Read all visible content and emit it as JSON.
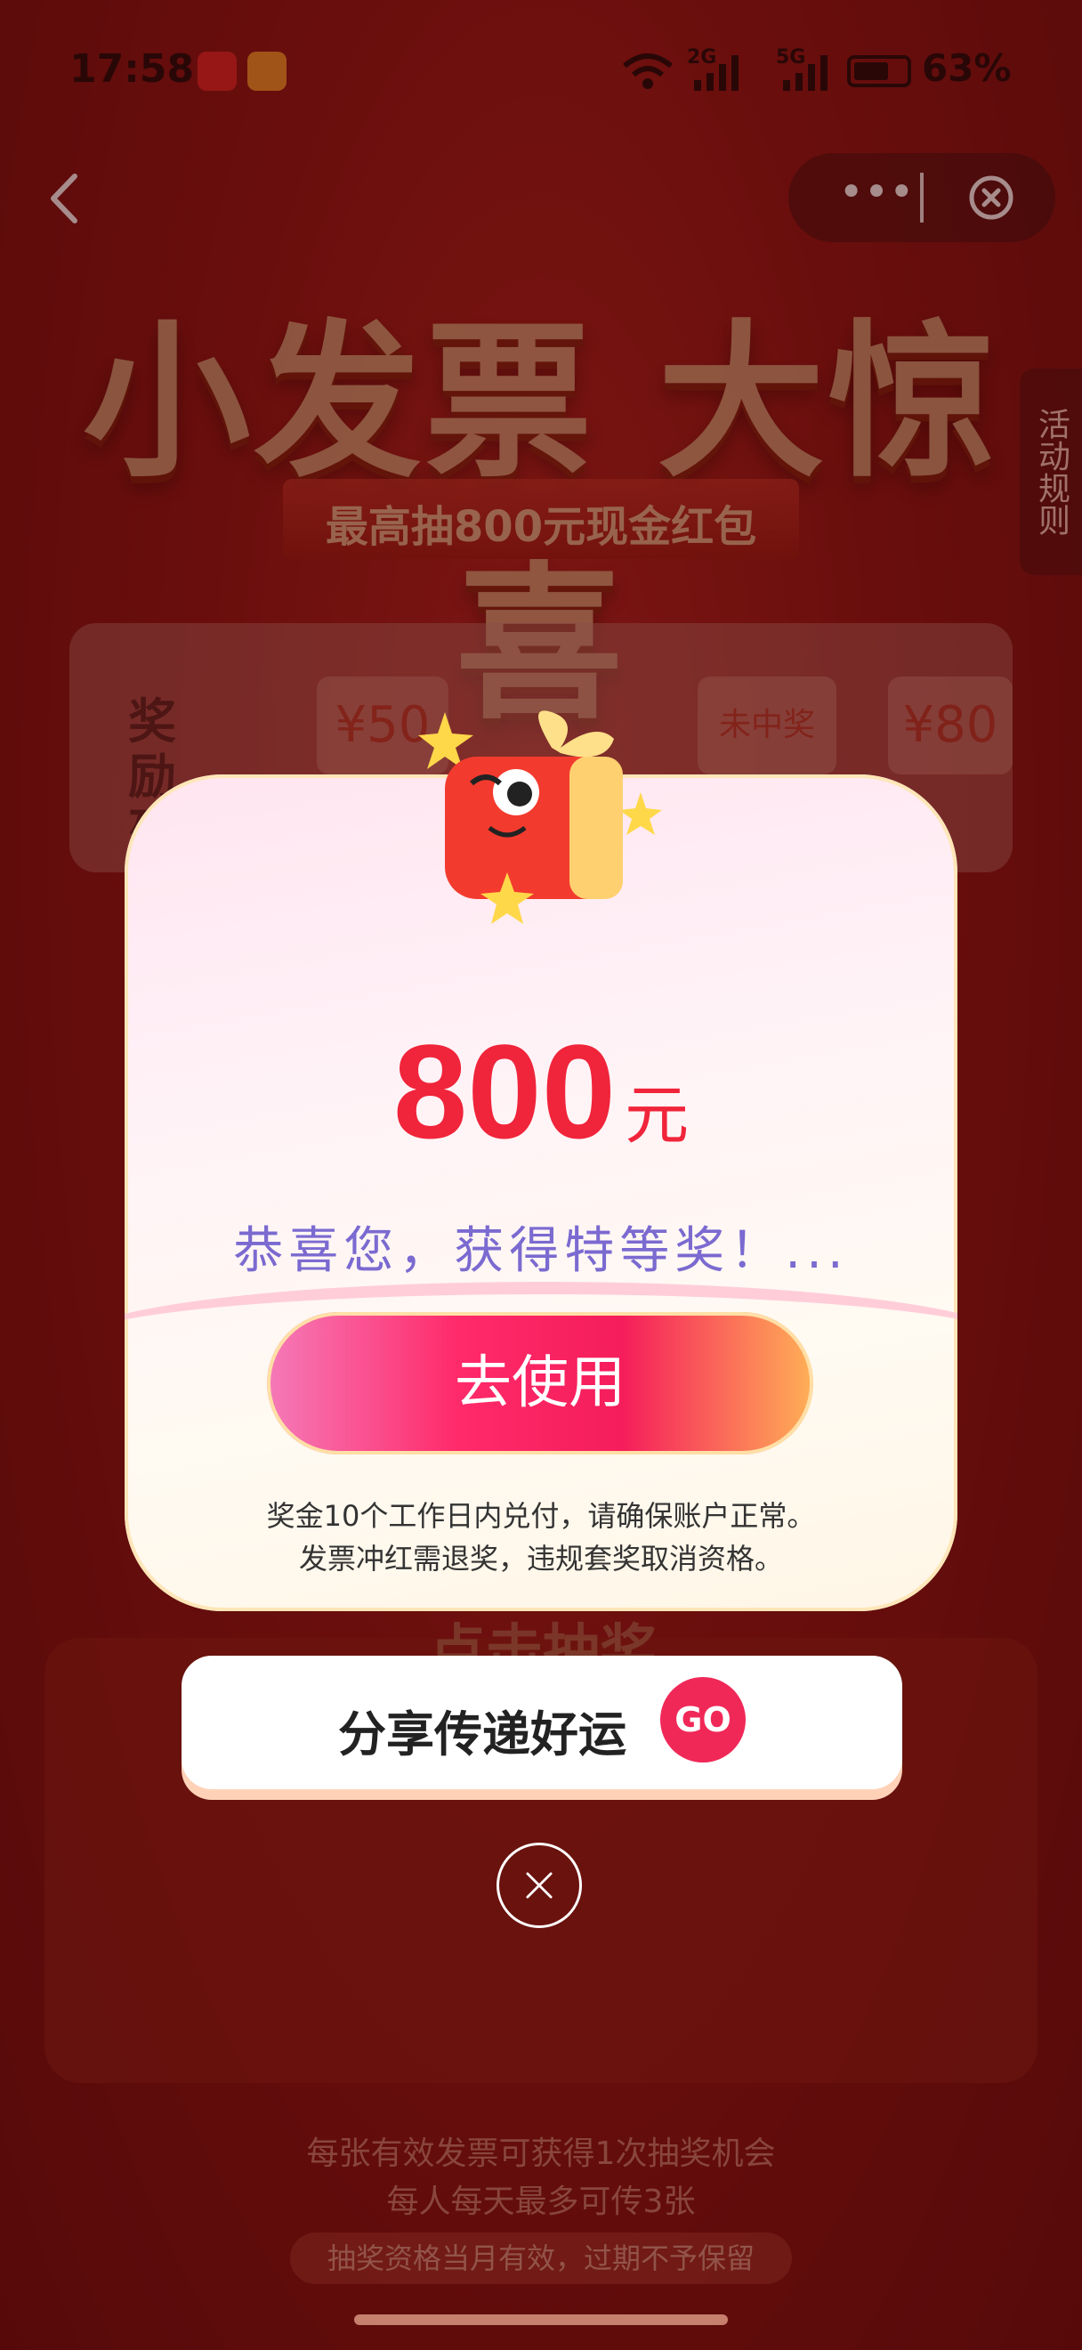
{
  "status_bar": {
    "time": "17:58",
    "battery_pct": "63%",
    "network1": "2G",
    "network2": "5G"
  },
  "capsule": {
    "more_label": "•••"
  },
  "header": {
    "title": "小发票 大惊喜",
    "subtitle": "最高抽800元现金红包",
    "rules_tab": "活动规则"
  },
  "prize_list": {
    "label": "奖励列表",
    "items": [
      {
        "label": "¥50"
      },
      {
        "label": "未中奖"
      },
      {
        "label": "¥80"
      }
    ]
  },
  "machine": {
    "button_text": "点击抽奖"
  },
  "modal": {
    "amount": "800",
    "unit": "元",
    "congrats": "恭喜您，获得特等奖！...",
    "use_button": "去使用",
    "note_line1": "奖金10个工作日内兑付，请确保账户正常。",
    "note_line2": "发票冲红需退奖，违规套奖取消资格。"
  },
  "share": {
    "label": "分享传递好运",
    "go": "GO"
  },
  "footer": {
    "line1": "每张有效发票可获得1次抽奖机会",
    "line2": "每人每天最多可传3张",
    "pill": "抽奖资格当月有效，过期不予保留"
  },
  "icons": [
    "back-arrow-icon",
    "more-icon",
    "close-icon",
    "gift-mascot-icon",
    "close-circle-icon"
  ]
}
